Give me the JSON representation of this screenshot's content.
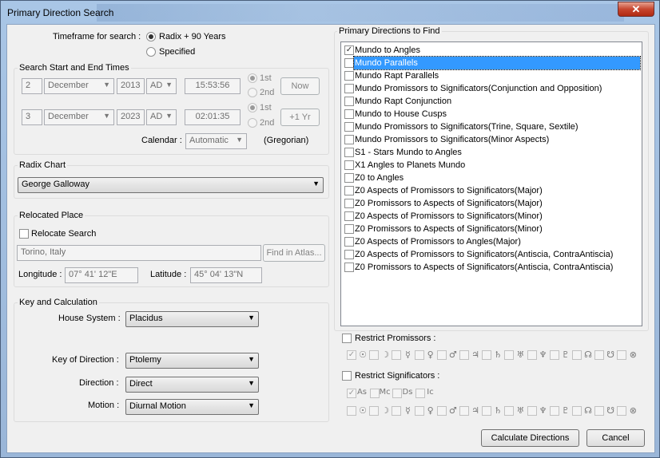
{
  "window": {
    "title": "Primary Direction Search",
    "close_glyph": "✕"
  },
  "timeframe": {
    "label": "Timeframe for search :",
    "opt_radix": "Radix + 90 Years",
    "opt_specified": "Specified"
  },
  "search": {
    "group": "Search Start and End Times",
    "start": {
      "day": "2",
      "month": "December",
      "year": "2013",
      "era": "AD",
      "time": "15:53:56",
      "opt1": "1st",
      "opt2": "2nd",
      "btn": "Now"
    },
    "end": {
      "day": "3",
      "month": "December",
      "year": "2023",
      "era": "AD",
      "time": "02:01:35",
      "opt1": "1st",
      "opt2": "2nd",
      "btn": "+1 Yr"
    },
    "calendar_label": "Calendar :",
    "calendar_value": "Automatic",
    "calendar_note": "(Gregorian)"
  },
  "radix": {
    "group": "Radix Chart",
    "value": "George Galloway"
  },
  "relocated": {
    "group": "Relocated Place",
    "checkbox": "Relocate Search",
    "place": "Torino, Italy",
    "find_btn": "Find in Atlas...",
    "lon_label": "Longitude :",
    "lon": "07° 41' 12\"E",
    "lat_label": "Latitude :",
    "lat": "45° 04' 13\"N"
  },
  "calc": {
    "group": "Key and Calculation",
    "house_label": "House System :",
    "house": "Placidus",
    "key_label": "Key of Direction :",
    "key": "Ptolemy",
    "dir_label": "Direction :",
    "dir": "Direct",
    "motion_label": "Motion :",
    "motion": "Diurnal Motion"
  },
  "find": {
    "group": "Primary Directions to Find",
    "items": [
      {
        "label": "Mundo to Angles",
        "checked": true
      },
      {
        "label": "Mundo Parallels",
        "checked": false,
        "selected": true
      },
      {
        "label": "Mundo Rapt Parallels",
        "checked": false
      },
      {
        "label": "Mundo Promissors to Significators(Conjunction and Opposition)",
        "checked": false
      },
      {
        "label": "Mundo Rapt Conjunction",
        "checked": false
      },
      {
        "label": "Mundo to House Cusps",
        "checked": false
      },
      {
        "label": "Mundo Promissors to Significators(Trine, Square, Sextile)",
        "checked": false
      },
      {
        "label": "Mundo Promissors to Significators(Minor Aspects)",
        "checked": false
      },
      {
        "label": "S1 - Stars Mundo to Angles",
        "checked": false
      },
      {
        "label": "X1 Angles to Planets Mundo",
        "checked": false
      },
      {
        "label": "Z0 to Angles",
        "checked": false
      },
      {
        "label": "Z0 Aspects of Promissors to Significators(Major)",
        "checked": false
      },
      {
        "label": "Z0 Promissors to Aspects of Significators(Major)",
        "checked": false
      },
      {
        "label": "Z0 Aspects of Promissors to Significators(Minor)",
        "checked": false
      },
      {
        "label": "Z0 Promissors to Aspects of Significators(Minor)",
        "checked": false
      },
      {
        "label": "Z0 Aspects of Promissors to Angles(Major)",
        "checked": false
      },
      {
        "label": "Z0 Aspects of Promissors to Significators(Antiscia, ContraAntiscia)",
        "checked": false
      },
      {
        "label": "Z0 Promissors to Aspects of Significators(Antiscia, ContraAntiscia)",
        "checked": false
      }
    ]
  },
  "restrict_prom": {
    "label": "Restrict Promissors :",
    "symbols": [
      "☉",
      "☽",
      "☿",
      "♀",
      "♂",
      "♃",
      "♄",
      "♅",
      "♆",
      "♇",
      "☊",
      "☋",
      "⊗"
    ]
  },
  "restrict_sig": {
    "label": "Restrict Significators :",
    "angles": [
      "As",
      "Mc",
      "Ds",
      "Ic"
    ],
    "symbols": [
      "☉",
      "☽",
      "☿",
      "♀",
      "♂",
      "♃",
      "♄",
      "♅",
      "♆",
      "♇",
      "☊",
      "☋",
      "⊗"
    ]
  },
  "buttons": {
    "calculate": "Calculate Directions",
    "cancel": "Cancel"
  },
  "icons": {
    "radio": "radio-button-icon",
    "checkbox": "checkbox-icon",
    "dropdown": "chevron-down-icon",
    "close": "close-icon"
  }
}
